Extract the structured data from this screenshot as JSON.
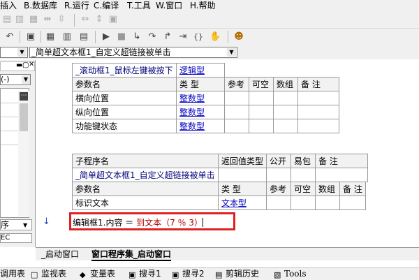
{
  "menu": {
    "items": [
      "插入",
      "B.数据库",
      "R.运行",
      "C.编译",
      "T.工具",
      "W.窗口",
      "H.帮助"
    ]
  },
  "toolbar": {
    "icons": [
      "undo-icon",
      "find-icon",
      "layout-1-icon",
      "layout-2-icon",
      "layout-3-icon",
      "run-icon",
      "stop-icon",
      "step-into-icon",
      "step-over-icon",
      "step-out-icon",
      "run-to-cursor-icon",
      "breakpoint-icon",
      "hand-icon",
      "people-icon"
    ]
  },
  "combo": {
    "left_value": "",
    "main_value": "_简单超文本框1_自定义超链接被单击"
  },
  "left_panel": {
    "select_value": "(-)",
    "label_a": "序",
    "label_b": "EC"
  },
  "table1": {
    "sub_row": [
      "_滚动框1_鼠标左键被按下",
      "逻辑型"
    ],
    "header": [
      "参数名",
      "类 型",
      "参考",
      "可空",
      "数组",
      "备 注"
    ],
    "rows": [
      [
        "横向位置",
        "整数型"
      ],
      [
        "纵向位置",
        "整数型"
      ],
      [
        "功能键状态",
        "整数型"
      ]
    ]
  },
  "table2": {
    "header1": [
      "子程序名",
      "返回值类型",
      "公开",
      "易包",
      "备 注"
    ],
    "sub_row": [
      "_简单超文本框1_自定义超链接被单击"
    ],
    "header2": [
      "参数名",
      "类 型",
      "参考",
      "可空",
      "数组",
      "备 注"
    ],
    "rows": [
      [
        "标识文本",
        "文本型"
      ]
    ]
  },
  "code": {
    "line_prefix": "编辑框1.内容 ＝ ",
    "line_call": "到文本（7 ％ 3）"
  },
  "tabs": {
    "tab1": "_启动窗口",
    "tab2": "窗口程序集_启动窗口"
  },
  "bottom_bar": {
    "items": [
      "调用表",
      "监视表",
      "变量表",
      "搜寻1",
      "搜寻2",
      "剪辑历史",
      "Tools"
    ]
  },
  "colors": {
    "highlight_box": "#e02020",
    "link_blue": "#0000c0"
  }
}
